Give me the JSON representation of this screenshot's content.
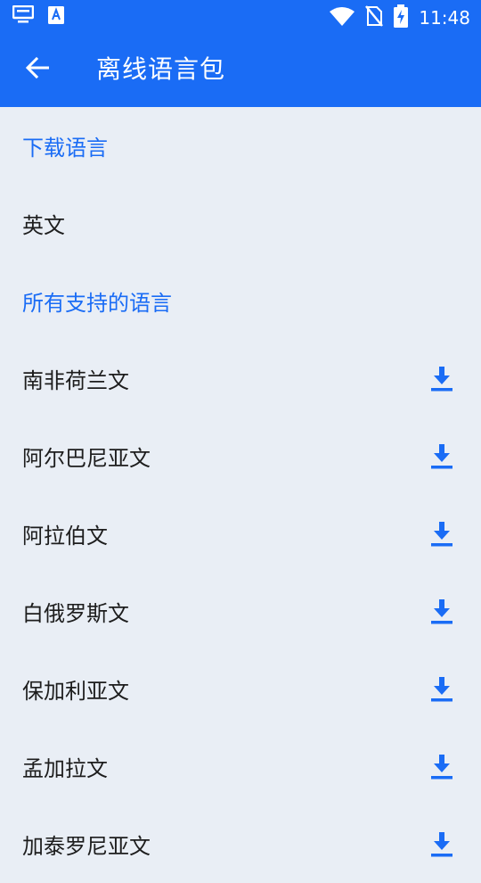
{
  "status_bar": {
    "time": "11:48",
    "icons": [
      "notification-icon",
      "translate-app-icon",
      "wifi-icon",
      "no-sim-icon",
      "battery-charging-icon"
    ]
  },
  "app_bar": {
    "back_icon": "arrow-back-icon",
    "title": "离线语言包"
  },
  "sections": {
    "downloaded": {
      "header": "下载语言",
      "items": [
        {
          "label": "英文"
        }
      ]
    },
    "supported": {
      "header": "所有支持的语言",
      "items": [
        {
          "label": "南非荷兰文",
          "icon": "download-icon"
        },
        {
          "label": "阿尔巴尼亚文",
          "icon": "download-icon"
        },
        {
          "label": "阿拉伯文",
          "icon": "download-icon"
        },
        {
          "label": "白俄罗斯文",
          "icon": "download-icon"
        },
        {
          "label": "保加利亚文",
          "icon": "download-icon"
        },
        {
          "label": "孟加拉文",
          "icon": "download-icon"
        },
        {
          "label": "加泰罗尼亚文",
          "icon": "download-icon"
        }
      ]
    }
  },
  "colors": {
    "primary": "#1a6cf5",
    "background": "#e9eef5",
    "text": "#1d1d1d"
  }
}
